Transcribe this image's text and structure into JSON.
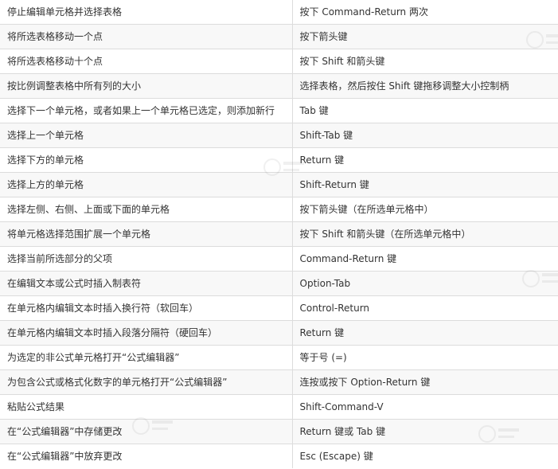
{
  "shortcuts": [
    {
      "action": "停止编辑单元格并选择表格",
      "keys": "按下 Command-Return 两次"
    },
    {
      "action": "将所选表格移动一个点",
      "keys": "按下箭头键"
    },
    {
      "action": "将所选表格移动十个点",
      "keys": "按下 Shift 和箭头键"
    },
    {
      "action": "按比例调整表格中所有列的大小",
      "keys": "选择表格，然后按住 Shift 键拖移调整大小控制柄"
    },
    {
      "action": "选择下一个单元格，或者如果上一个单元格已选定，则添加新行",
      "keys": "Tab 键"
    },
    {
      "action": "选择上一个单元格",
      "keys": "Shift-Tab 键"
    },
    {
      "action": "选择下方的单元格",
      "keys": "Return 键"
    },
    {
      "action": "选择上方的单元格",
      "keys": "Shift-Return 键"
    },
    {
      "action": "选择左侧、右侧、上面或下面的单元格",
      "keys": "按下箭头键（在所选单元格中）"
    },
    {
      "action": "将单元格选择范围扩展一个单元格",
      "keys": "按下 Shift 和箭头键（在所选单元格中）"
    },
    {
      "action": "选择当前所选部分的父项",
      "keys": "Command-Return 键"
    },
    {
      "action": "在编辑文本或公式时插入制表符",
      "keys": "Option-Tab"
    },
    {
      "action": "在单元格内编辑文本时插入换行符（软回车）",
      "keys": "Control-Return"
    },
    {
      "action": "在单元格内编辑文本时插入段落分隔符（硬回车）",
      "keys": "Return 键"
    },
    {
      "action": "为选定的非公式单元格打开“公式编辑器”",
      "keys": "等于号 (=)"
    },
    {
      "action": "为包含公式或格式化数字的单元格打开“公式编辑器”",
      "keys": "连按或按下 Option-Return 键"
    },
    {
      "action": "粘贴公式结果",
      "keys": "Shift-Command-V"
    },
    {
      "action": "在“公式编辑器”中存储更改",
      "keys": "Return 键或 Tab 键"
    },
    {
      "action": "在“公式编辑器”中放弃更改",
      "keys": "Esc (Escape) 键"
    }
  ]
}
